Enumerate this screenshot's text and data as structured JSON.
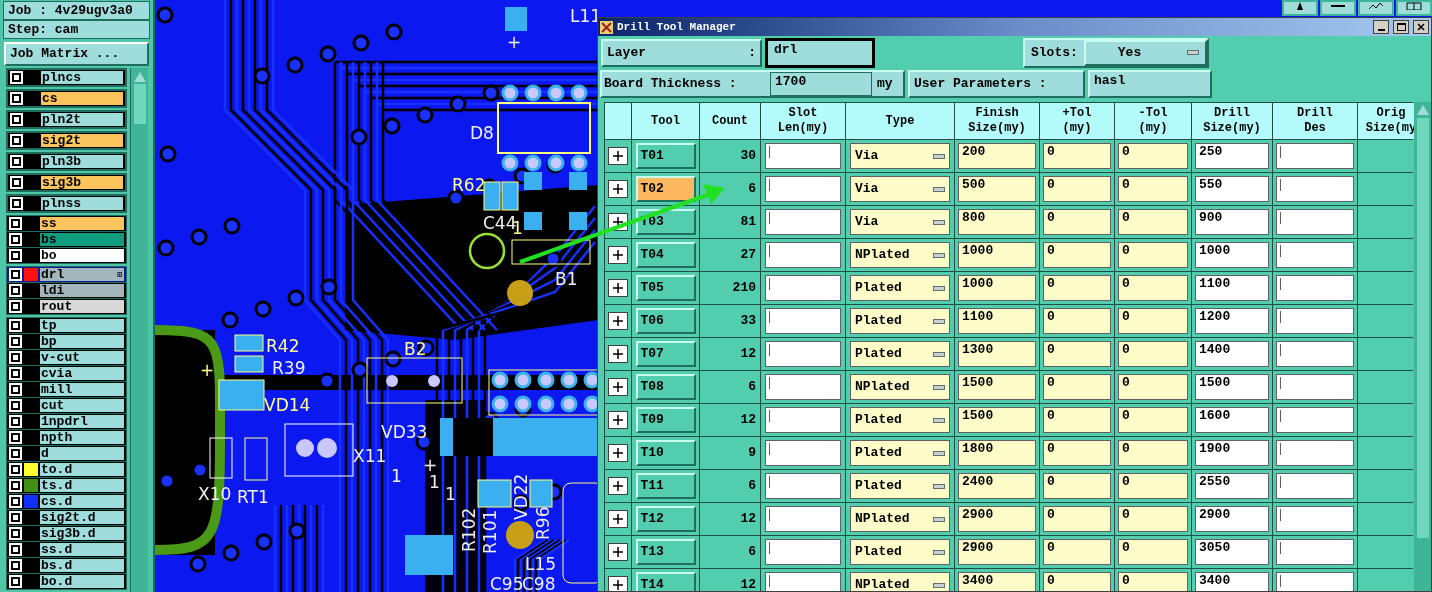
{
  "left_panel": {
    "job": "Job : 4v29ugv3a0",
    "step": "Step: cam",
    "matrix_button": "Job Matrix ...",
    "layer_groups": [
      {
        "kind": "separate",
        "layers": [
          {
            "name": "plncs",
            "kind": "plane",
            "selected": false
          },
          {
            "name": "cs",
            "kind": "signal",
            "selected": false
          },
          {
            "name": "pln2t",
            "kind": "plane",
            "selected": false
          },
          {
            "name": "sig2t",
            "kind": "signal",
            "selected": false
          },
          {
            "name": "pln3b",
            "kind": "plane",
            "selected": false
          },
          {
            "name": "sig3b",
            "kind": "signal",
            "selected": false
          },
          {
            "name": "plnss",
            "kind": "plane",
            "selected": false
          }
        ]
      },
      {
        "kind": "joined",
        "layers": [
          {
            "name": "ss",
            "kind": "signal",
            "selected": false
          },
          {
            "name": "bs",
            "kind": "mask",
            "selected": false
          },
          {
            "name": "bo",
            "kind": "silk",
            "selected": false
          }
        ]
      },
      {
        "kind": "joined",
        "layers": [
          {
            "name": "drl",
            "kind": "drill",
            "color": "#ff1010",
            "marker": "⊞",
            "selected": true
          },
          {
            "name": "ldi",
            "kind": "drill",
            "selected": false
          },
          {
            "name": "rout",
            "kind": "rout",
            "selected": false
          }
        ]
      },
      {
        "kind": "joined",
        "layers": [
          {
            "name": "tp",
            "kind": "document",
            "selected": false
          },
          {
            "name": "bp",
            "kind": "document",
            "selected": false
          },
          {
            "name": "v-cut",
            "kind": "document",
            "selected": false
          },
          {
            "name": "cvia",
            "kind": "document",
            "selected": false
          },
          {
            "name": "mill",
            "kind": "document",
            "selected": false
          },
          {
            "name": "cut",
            "kind": "document",
            "selected": false
          },
          {
            "name": "1npdrl",
            "kind": "document",
            "selected": false
          },
          {
            "name": "npth",
            "kind": "document",
            "selected": false
          },
          {
            "name": "d",
            "kind": "document",
            "selected": false
          },
          {
            "name": "to.d",
            "kind": "document",
            "color": "#ffff30",
            "selected": false
          },
          {
            "name": "ts.d",
            "kind": "document",
            "color": "#3f9010",
            "selected": false
          },
          {
            "name": "cs.d",
            "kind": "document",
            "color": "#1030ff",
            "selected": false
          },
          {
            "name": "sig2t.d",
            "kind": "document",
            "selected": false
          },
          {
            "name": "sig3b.d",
            "kind": "document",
            "selected": false
          },
          {
            "name": "ss.d",
            "kind": "document",
            "selected": false
          },
          {
            "name": "bs.d",
            "kind": "document",
            "selected": false
          },
          {
            "name": "bo.d",
            "kind": "document",
            "selected": false
          }
        ]
      }
    ]
  },
  "board": {
    "labels": [
      {
        "text": "L11",
        "color": "#f0f0f0"
      },
      {
        "text": "+",
        "color": "#f0f0f0"
      },
      {
        "text": "D8",
        "color": "#f0f0f0"
      },
      {
        "text": "R62",
        "color": "#ffff90"
      },
      {
        "text": "C44",
        "color": "#f0f0f0"
      },
      {
        "text": "1",
        "color": "#ffff90"
      },
      {
        "text": "B1",
        "color": "#f0f0f0"
      },
      {
        "text": "R42",
        "color": "#ffff90"
      },
      {
        "text": "R39",
        "color": "#f0f0f0"
      },
      {
        "text": "+",
        "color": "#ffff90"
      },
      {
        "text": "VD14",
        "color": "#ffff90"
      },
      {
        "text": "B2",
        "color": "#ffff90"
      },
      {
        "text": "VD33",
        "color": "#f0f0f0"
      },
      {
        "text": "+",
        "color": "#f0f0f0"
      },
      {
        "text": "X11",
        "color": "#f0f0f0"
      },
      {
        "text": "1",
        "color": "#f0f0f0"
      },
      {
        "text": "X10",
        "color": "#f0f0f0"
      },
      {
        "text": "RT1",
        "color": "#f0f0f0"
      },
      {
        "text": "1",
        "color": "#f0f0f0"
      },
      {
        "text": "1",
        "color": "#f0f0f0"
      },
      {
        "text": "R102",
        "color": "#f0f0f0"
      },
      {
        "text": "R101",
        "color": "#f0f0f0"
      },
      {
        "text": "VD22",
        "color": "#f0f0f0"
      },
      {
        "text": "R96",
        "color": "#f0f0f0"
      },
      {
        "text": "L15",
        "color": "#f0f0f0"
      },
      {
        "text": "C95",
        "color": "#f0f0f0"
      },
      {
        "text": "C98",
        "color": "#f0f0f0"
      }
    ]
  },
  "dialog": {
    "title": "Drill Tool Manager",
    "layer": {
      "label": "Layer",
      "colon": ":",
      "value": "drl"
    },
    "slots": {
      "label": "Slots:",
      "value": "Yes"
    },
    "thickness": {
      "label": "Board Thickness :",
      "value": "1700",
      "unit": "my"
    },
    "user_parameters": {
      "label": "User Parameters :",
      "value": "hasl"
    },
    "table": {
      "columns": [
        [
          "Tool"
        ],
        [
          "Count"
        ],
        [
          "Slot",
          "Len(my)"
        ],
        [
          "Type"
        ],
        [
          "Finish",
          "Size(my)"
        ],
        [
          "+Tol",
          "(my)"
        ],
        [
          "-Tol",
          "(my)"
        ],
        [
          "Drill",
          "Size(my)"
        ],
        [
          "Drill",
          "Des"
        ],
        [
          "Orig",
          "Size(my"
        ]
      ],
      "rows": [
        {
          "tool": "T01",
          "count": "30",
          "type": "Via",
          "finish": "200",
          "plus_tol": "0",
          "minus_tol": "0",
          "drill_size": "250",
          "selected": false
        },
        {
          "tool": "T02",
          "count": "6",
          "type": "Via",
          "finish": "500",
          "plus_tol": "0",
          "minus_tol": "0",
          "drill_size": "550",
          "selected": true
        },
        {
          "tool": "T03",
          "count": "81",
          "type": "Via",
          "finish": "800",
          "plus_tol": "0",
          "minus_tol": "0",
          "drill_size": "900",
          "selected": false
        },
        {
          "tool": "T04",
          "count": "27",
          "type": "NPlated",
          "finish": "1000",
          "plus_tol": "0",
          "minus_tol": "0",
          "drill_size": "1000",
          "selected": false
        },
        {
          "tool": "T05",
          "count": "210",
          "type": "Plated",
          "finish": "1000",
          "plus_tol": "0",
          "minus_tol": "0",
          "drill_size": "1100",
          "selected": false
        },
        {
          "tool": "T06",
          "count": "33",
          "type": "Plated",
          "finish": "1100",
          "plus_tol": "0",
          "minus_tol": "0",
          "drill_size": "1200",
          "selected": false
        },
        {
          "tool": "T07",
          "count": "12",
          "type": "Plated",
          "finish": "1300",
          "plus_tol": "0",
          "minus_tol": "0",
          "drill_size": "1400",
          "selected": false
        },
        {
          "tool": "T08",
          "count": "6",
          "type": "NPlated",
          "finish": "1500",
          "plus_tol": "0",
          "minus_tol": "0",
          "drill_size": "1500",
          "selected": false
        },
        {
          "tool": "T09",
          "count": "12",
          "type": "Plated",
          "finish": "1500",
          "plus_tol": "0",
          "minus_tol": "0",
          "drill_size": "1600",
          "selected": false
        },
        {
          "tool": "T10",
          "count": "9",
          "type": "Plated",
          "finish": "1800",
          "plus_tol": "0",
          "minus_tol": "0",
          "drill_size": "1900",
          "selected": false
        },
        {
          "tool": "T11",
          "count": "6",
          "type": "Plated",
          "finish": "2400",
          "plus_tol": "0",
          "minus_tol": "0",
          "drill_size": "2550",
          "selected": false
        },
        {
          "tool": "T12",
          "count": "12",
          "type": "NPlated",
          "finish": "2900",
          "plus_tol": "0",
          "minus_tol": "0",
          "drill_size": "2900",
          "selected": false
        },
        {
          "tool": "T13",
          "count": "6",
          "type": "Plated",
          "finish": "2900",
          "plus_tol": "0",
          "minus_tol": "0",
          "drill_size": "3050",
          "selected": false
        },
        {
          "tool": "T14",
          "count": "12",
          "type": "NPlated",
          "finish": "3400",
          "plus_tol": "0",
          "minus_tol": "0",
          "drill_size": "3400",
          "selected": false
        }
      ]
    }
  }
}
